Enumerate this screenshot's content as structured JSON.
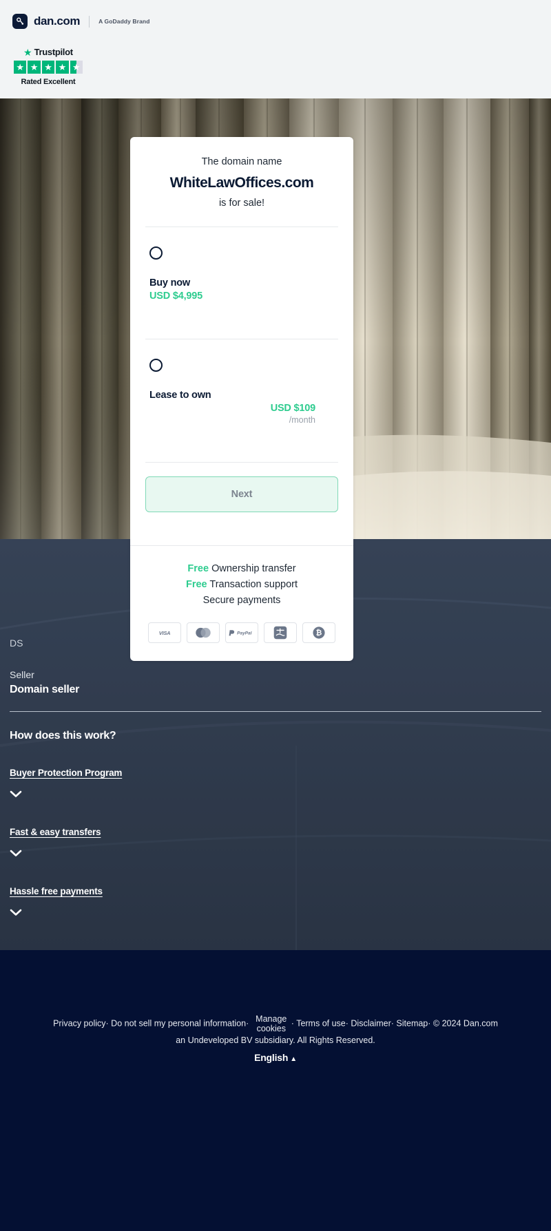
{
  "header": {
    "brand_name": "dan.com",
    "brand_icon": "dan-logo-icon",
    "godaddy_tagline": "A GoDaddy Brand",
    "trustpilot": {
      "name": "Trustpilot",
      "star_icon": "trustpilot-star-icon",
      "stars_filled": 4,
      "stars_half": 1,
      "rating_text": "Rated Excellent"
    }
  },
  "card": {
    "intro": "The domain name",
    "domain": "WhiteLawOffices.com",
    "for_sale": "is for sale!",
    "options": [
      {
        "id": "buy-now",
        "title": "Buy now",
        "price": "USD $4,995",
        "period": "",
        "selected": false
      },
      {
        "id": "lease-to-own",
        "title": "Lease to own",
        "price": "USD $109",
        "period": "/month",
        "selected": false
      }
    ],
    "next_label": "Next",
    "benefits": [
      {
        "free": "Free",
        "text": " Ownership transfer"
      },
      {
        "free": "Free",
        "text": " Transaction support"
      },
      {
        "free": "",
        "text": "Secure payments"
      }
    ],
    "payment_methods": [
      {
        "name": "visa-icon",
        "label": "VISA"
      },
      {
        "name": "mastercard-icon",
        "label": "Mastercard"
      },
      {
        "name": "paypal-icon",
        "label": "PayPal"
      },
      {
        "name": "alipay-icon",
        "label": "Alipay"
      },
      {
        "name": "bitcoin-icon",
        "label": "Bitcoin"
      }
    ]
  },
  "seller": {
    "initials": "DS",
    "label": "Seller",
    "name": "Domain seller"
  },
  "how_it_works": {
    "title": "How does this work?",
    "items": [
      {
        "label": "Buyer Protection Program",
        "chevron": "chevron-down-icon"
      },
      {
        "label": "Fast & easy transfers",
        "chevron": "chevron-down-icon"
      },
      {
        "label": "Hassle free payments",
        "chevron": "chevron-down-icon"
      }
    ]
  },
  "footer": {
    "privacy_policy": "Privacy policy",
    "do_not_sell": "Do not sell my personal information",
    "manage_cookies": "Manage cookies",
    "terms_of_use": "Terms of use",
    "disclaimer": "Disclaimer",
    "sitemap": "Sitemap",
    "copyright": "© 2024 Dan.com",
    "subsidiary_line": "an Undeveloped BV subsidiary. All Rights Reserved.",
    "separator": "·",
    "language": "English",
    "language_caret": "caret-up-icon"
  },
  "colors": {
    "accent_green": "#2ecc8f",
    "trustpilot_green": "#00b67a",
    "dark_navy": "#0b1a33",
    "footer_navy": "#041033",
    "mid_navy": "#3a4657"
  }
}
